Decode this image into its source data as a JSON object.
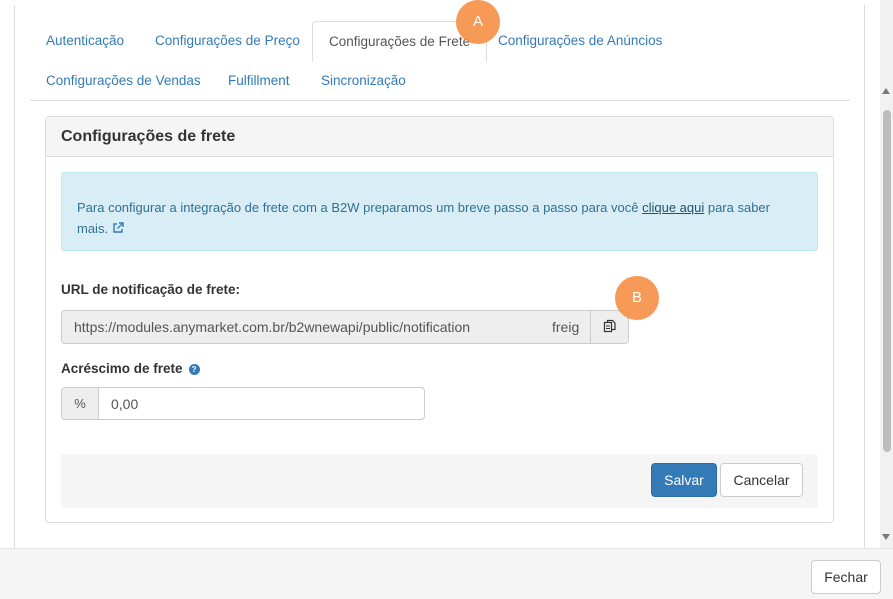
{
  "tabs": [
    {
      "label": "Autenticação",
      "active": false
    },
    {
      "label": "Configurações de Preço",
      "active": false
    },
    {
      "label": "Configurações de Frete",
      "active": true
    },
    {
      "label": "Configurações de Anúncios",
      "active": false
    },
    {
      "label": "Configurações de Vendas",
      "active": false
    },
    {
      "label": "Fulfillment",
      "active": false
    },
    {
      "label": "Sincronização",
      "active": false
    }
  ],
  "panel": {
    "title": "Configurações de frete",
    "alert": {
      "text_before": "Para configurar a integração de frete com a B2W preparamos um breve passo a passo para você ",
      "link_text": "clique aqui",
      "text_after": " para saber mais.",
      "icon": "external-link-icon"
    },
    "url_field": {
      "label": "URL de notificação de frete:",
      "value_part1": "https://modules.anymarket.com.br/b2wnewapi/public/notification",
      "value_part2": "freig",
      "copy_icon": "copy-icon"
    },
    "freight_field": {
      "label": "Acréscimo de frete",
      "help_icon": "question-circle-icon",
      "addon": "%",
      "value": "0,00"
    },
    "buttons": {
      "save": "Salvar",
      "cancel": "Cancelar"
    }
  },
  "annotations": {
    "a": "A",
    "b": "B"
  },
  "footer": {
    "close": "Fechar"
  },
  "colors": {
    "primary": "#337ab7",
    "alert_bg": "#d9edf7",
    "alert_text": "#31708f",
    "badge": "#f7924a"
  }
}
